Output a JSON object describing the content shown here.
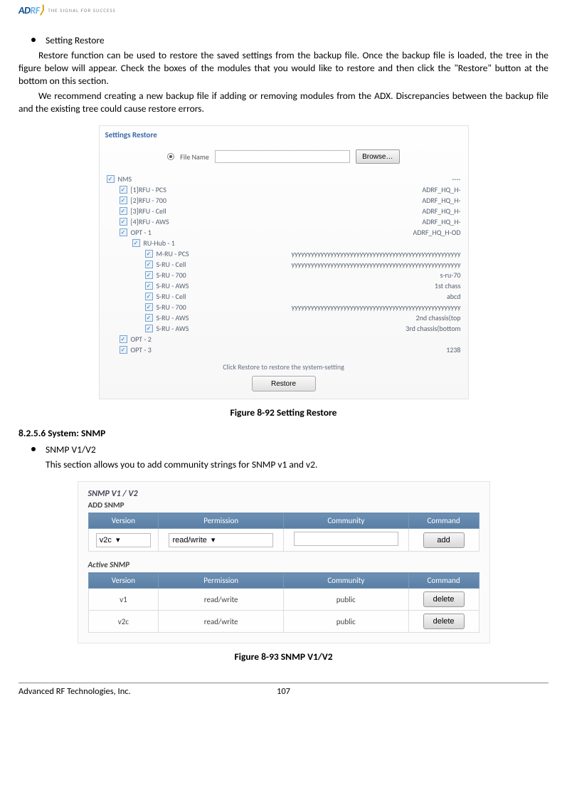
{
  "logo": {
    "ad": "AD",
    "rf": "RF",
    "tagline": "THE SIGNAL FOR SUCCESS"
  },
  "bullets": {
    "setting_restore": "Setting Restore",
    "snmp_v1v2": "SNMP V1/V2"
  },
  "paragraphs": {
    "p1": "Restore function can be used to restore the saved settings from the backup file.  Once the backup file is loaded, the tree in the figure below will appear.  Check the boxes of the modules that you would like to restore and then click the \"Restore\" button at the bottom on this section.",
    "p2": "We recommend creating a new backup file if adding or removing modules from the ADX.  Discrepancies between the backup file and the existing tree could cause restore errors.",
    "p3": "This section allows you to add community strings for SNMP v1 and v2."
  },
  "fig1": {
    "title": "Settings Restore",
    "file_label": "File Name",
    "browse": "Browse…",
    "rows": [
      {
        "ind": 0,
        "label": "NMS",
        "val": "----"
      },
      {
        "ind": 1,
        "label": "[1]RFU - PCS",
        "val": "ADRF_HQ_H-"
      },
      {
        "ind": 1,
        "label": "[2]RFU - 700",
        "val": "ADRF_HQ_H-"
      },
      {
        "ind": 1,
        "label": "[3]RFU - Cell",
        "val": "ADRF_HQ_H-"
      },
      {
        "ind": 1,
        "label": "[4]RFU - AWS",
        "val": "ADRF_HQ_H-"
      },
      {
        "ind": 1,
        "label": "OPT - 1",
        "val": "ADRF_HQ_H-OD"
      },
      {
        "ind": 2,
        "label": "RU-Hub - 1",
        "val": ""
      },
      {
        "ind": 3,
        "label": "M-RU - PCS",
        "val": "yyyyyyyyyyyyyyyyyyyyyyyyyyyyyyyyyyyyyyyyyyyyyyyyyyyy"
      },
      {
        "ind": 3,
        "label": "S-RU - Cell",
        "val": "yyyyyyyyyyyyyyyyyyyyyyyyyyyyyyyyyyyyyyyyyyyyyyyyyyyy"
      },
      {
        "ind": 3,
        "label": "S-RU - 700",
        "val": "s-ru-70"
      },
      {
        "ind": 3,
        "label": "S-RU - AWS",
        "val": "1st chass"
      },
      {
        "ind": 3,
        "label": "S-RU - Cell",
        "val": "abcd"
      },
      {
        "ind": 3,
        "label": "S-RU - 700",
        "val": "yyyyyyyyyyyyyyyyyyyyyyyyyyyyyyyyyyyyyyyyyyyyyyyyyyyy"
      },
      {
        "ind": 3,
        "label": "S-RU - AWS",
        "val": "2nd chassis(top"
      },
      {
        "ind": 3,
        "label": "S-RU - AWS",
        "val": "3rd chassis(bottom"
      },
      {
        "ind": 1,
        "label": "OPT - 2",
        "val": ""
      },
      {
        "ind": 1,
        "label": "OPT - 3",
        "val": "1238"
      }
    ],
    "hint": "Click Restore to restore the system-setting",
    "restore": "Restore"
  },
  "captions": {
    "c1": "Figure 8-92   Setting Restore",
    "c2": "Figure 8-93   SNMP V1/V2"
  },
  "sec_heading": "8.2.5.6   System: SNMP",
  "fig2": {
    "title": "SNMP V1 / V2",
    "add_label": "ADD SNMP",
    "headers": {
      "version": "Version",
      "permission": "Permission",
      "community": "Community",
      "command": "Command"
    },
    "add_row": {
      "version": "v2c",
      "permission": "read/write",
      "community": "",
      "btn": "add"
    },
    "active_label": "Active SNMP",
    "rows": [
      {
        "version": "v1",
        "permission": "read/write",
        "community": "public",
        "btn": "delete"
      },
      {
        "version": "v2c",
        "permission": "read/write",
        "community": "public",
        "btn": "delete"
      }
    ]
  },
  "footer": {
    "company": "Advanced RF Technologies, Inc.",
    "page": "107"
  }
}
